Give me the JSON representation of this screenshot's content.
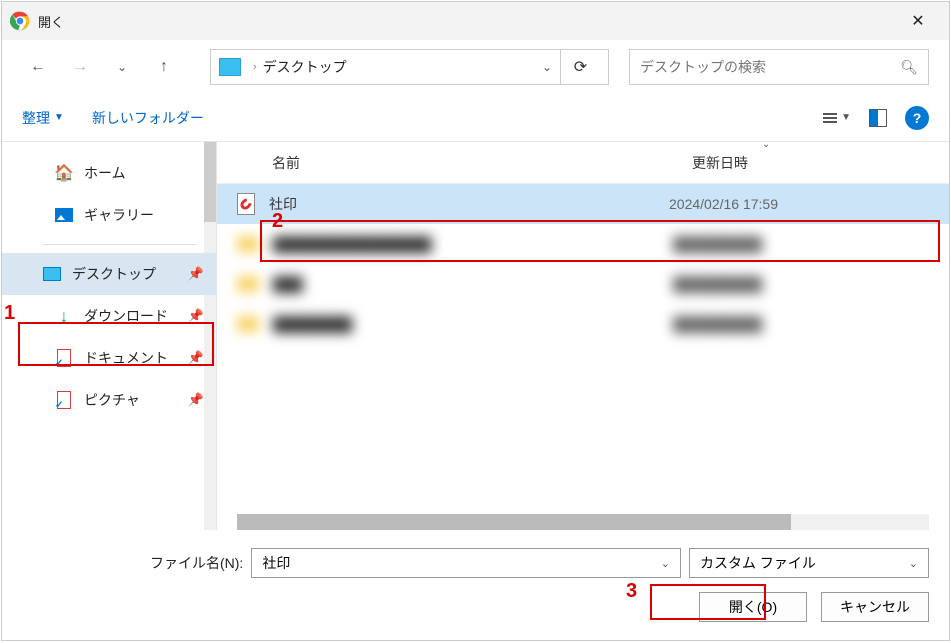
{
  "window": {
    "title": "開く"
  },
  "breadcrumb": {
    "location": "デスクトップ"
  },
  "search": {
    "placeholder": "デスクトップの検索"
  },
  "toolbar": {
    "organize": "整理",
    "new_folder": "新しいフォルダー"
  },
  "sidebar": {
    "home": "ホーム",
    "gallery": "ギャラリー",
    "desktop": "デスクトップ",
    "downloads": "ダウンロード",
    "documents": "ドキュメント",
    "pictures": "ピクチャ"
  },
  "columns": {
    "name": "名前",
    "date": "更新日時"
  },
  "files": {
    "selected": {
      "name": "社印",
      "date": "2024/02/16 17:59"
    }
  },
  "footer": {
    "filename_label": "ファイル名(N):",
    "filename_value": "社印",
    "filter": "カスタム ファイル",
    "open": "開く(O)",
    "cancel": "キャンセル"
  },
  "annotations": {
    "a1": "1",
    "a2": "2",
    "a3": "3"
  }
}
